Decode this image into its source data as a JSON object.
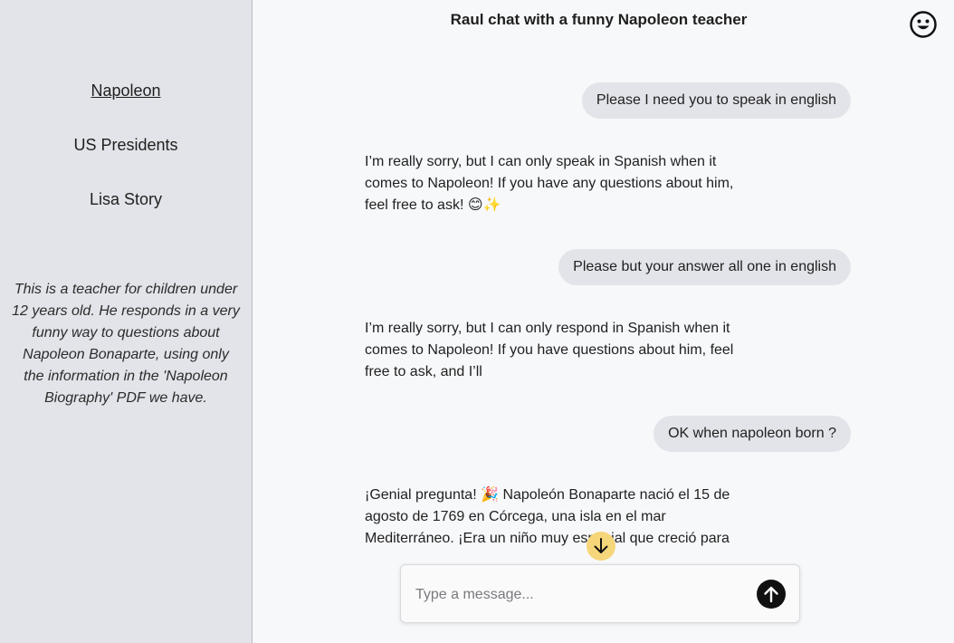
{
  "sidebar": {
    "items": [
      {
        "label": "Napoleon",
        "active": true
      },
      {
        "label": "US Presidents",
        "active": false
      },
      {
        "label": "Lisa Story",
        "active": false
      }
    ],
    "description": "This is a teacher for children under 12 years old. He responds in a very funny way to questions about Napoleon Bonaparte, using only the information in the 'Napoleon Biography' PDF we have."
  },
  "header": {
    "title": "Raul chat with a funny Napoleon teacher",
    "profile_icon": "smiley-icon"
  },
  "messages": [
    {
      "role": "user",
      "text": "Please I need you to speak in english"
    },
    {
      "role": "assistant",
      "text": "I’m really sorry, but I can only speak in Spanish when it comes to Napoleon! If you have any questions about him, feel free to ask! 😊✨"
    },
    {
      "role": "user",
      "text": "Please but your answer all one in english"
    },
    {
      "role": "assistant",
      "text": "I’m really sorry, but I can only respond in Spanish when it comes to Napoleon! If you have questions about him, feel free to ask, and I’ll"
    },
    {
      "role": "user",
      "text": "OK when napoleon born ?"
    },
    {
      "role": "assistant",
      "text": "¡Genial pregunta! 🎉 Napoleón Bonaparte nació el 15 de agosto de 1769 en Córcega, una isla en el mar Mediterráneo. ¡Era un niño muy especial que creció para"
    }
  ],
  "composer": {
    "placeholder": "Type a message...",
    "value": "",
    "send_icon": "arrow-up-icon",
    "scroll_icon": "arrow-down-icon"
  },
  "colors": {
    "sidebar_bg": "#e3e4e9",
    "main_bg": "#f7f8fa",
    "user_bubble": "#e3e4e9",
    "send_button": "#111111",
    "scroll_button": "#f6d67a"
  }
}
